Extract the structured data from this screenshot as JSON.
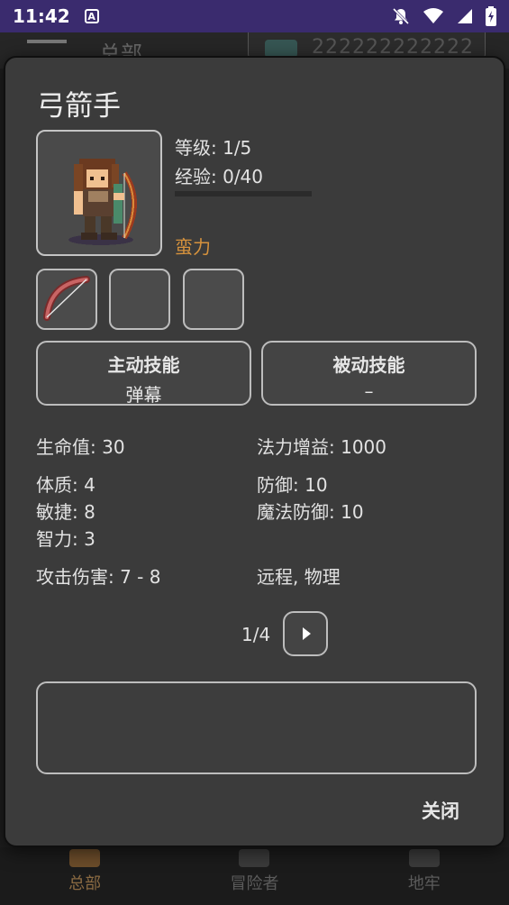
{
  "status_bar": {
    "time": "11:42",
    "notification_icon": "A"
  },
  "background": {
    "title": "总部",
    "currency_value": "222222222222",
    "nav": [
      {
        "label": "总部",
        "icon": "castle-icon",
        "active": true
      },
      {
        "label": "冒险者",
        "icon": "group-icon",
        "active": false
      },
      {
        "label": "地牢",
        "icon": "dungeon-icon",
        "active": false
      }
    ]
  },
  "dialog": {
    "hero_name": "弓箭手",
    "level": "等级: 1/5",
    "exp": "经验: 0/40",
    "exp_progress": 0,
    "trait": "蛮力",
    "trait_color": "#d6923d",
    "equipment": [
      {
        "icon": "bow-icon",
        "filled": true
      },
      {
        "icon": "empty-slot",
        "filled": false
      },
      {
        "icon": "empty-slot",
        "filled": false
      }
    ],
    "active_skill": {
      "title": "主动技能",
      "value": "弹幕"
    },
    "passive_skill": {
      "title": "被动技能",
      "value": "–"
    },
    "stats": {
      "hp": "生命值: 30",
      "mana_gain": "法力增益: 1000",
      "constitution": "体质: 4",
      "defense": "防御: 10",
      "agility": "敏捷: 8",
      "magic_defense": "魔法防御: 10",
      "intelligence": "智力: 3",
      "attack_damage": "攻击伤害: 7 - 8",
      "attack_type": "远程, 物理"
    },
    "pager": "1/4",
    "description": "",
    "close_label": "关闭"
  }
}
